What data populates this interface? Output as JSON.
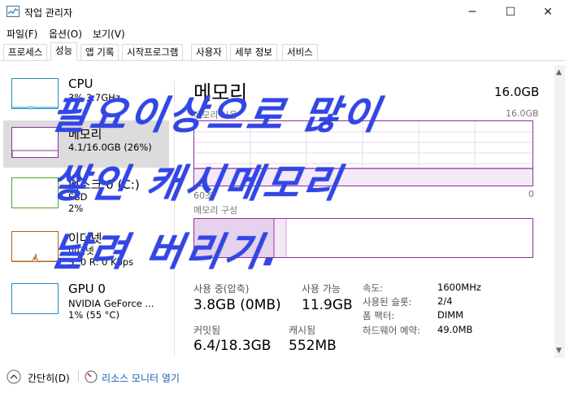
{
  "window": {
    "title": "작업 관리자",
    "min": "─",
    "max": "☐",
    "close": "✕"
  },
  "menu": [
    "파일(F)",
    "옵션(O)",
    "보기(V)"
  ],
  "tabs": [
    "프로세스",
    "성능",
    "앱 기록",
    "시작프로그램",
    "사용자",
    "세부 정보",
    "서비스"
  ],
  "active_tab": "성능",
  "sidebar": {
    "items": [
      {
        "title": "CPU",
        "sub1": "3% 3.7GHz",
        "sub2": "",
        "color": "#1f8fc7"
      },
      {
        "title": "메모리",
        "sub1": "4.1/16.0GB (26%)",
        "sub2": "",
        "color": "#8b2fa3"
      },
      {
        "title": "디스크 0 (C:)",
        "sub1": "SSD",
        "sub2": "2%",
        "color": "#4da61e"
      },
      {
        "title": "이더넷",
        "sub1": "이더넷",
        "sub2": "S: 0 R: 0 Kbps",
        "color": "#a8651e"
      },
      {
        "title": "GPU 0",
        "sub1": "NVIDIA GeForce ...",
        "sub2": "1% (55 °C)",
        "color": "#1f8fc7"
      }
    ]
  },
  "main": {
    "title": "메모리",
    "total": "16.0GB",
    "usage_label": "메모리 사용",
    "usage_max": "16.0GB",
    "axis_right_zero": "0",
    "axis_left": "60초",
    "composition_label": "메모리 구성",
    "stats": {
      "in_use_label": "사용 중(압축)",
      "in_use_value": "3.8GB (0MB)",
      "available_label": "사용 가능",
      "available_value": "11.9GB",
      "committed_label": "커밋됨",
      "committed_value": "6.4/18.3GB",
      "cached_label": "캐시됨",
      "cached_value": "552MB"
    },
    "specs": [
      {
        "label": "속도:",
        "value": "1600MHz"
      },
      {
        "label": "사용된 슬롯:",
        "value": "2/4"
      },
      {
        "label": "폼 팩터:",
        "value": "DIMM"
      },
      {
        "label": "하드웨어 예약:",
        "value": "49.0MB"
      }
    ]
  },
  "footer": {
    "fewer_details": "간단히(D)",
    "resource_monitor": "리소스 모니터 열기"
  },
  "overlay": {
    "line1": "필요이상으로 많이",
    "line2": "쌓인 캐시메모리",
    "line3": "날려 버리기."
  },
  "colors": {
    "memory_accent": "#8b2fa3",
    "overlay_text": "#3246e6",
    "link": "#1a5fb4"
  }
}
